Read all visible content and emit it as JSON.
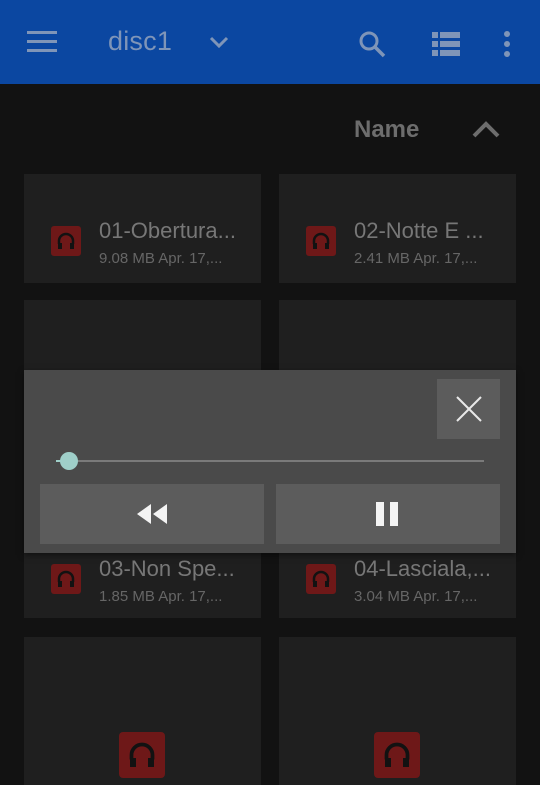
{
  "appbar": {
    "folder_title": "disc1",
    "background": "#0b47a1"
  },
  "sort": {
    "label": "Name",
    "direction": "ascending"
  },
  "files": [
    {
      "name": "01-Obertura...",
      "size": "9.08 MB",
      "date": "Apr. 17,..."
    },
    {
      "name": "02-Notte E ...",
      "size": "2.41 MB",
      "date": "Apr. 17,..."
    },
    {
      "name": "03-Non Spe...",
      "size": "1.85 MB",
      "date": "Apr. 17,..."
    },
    {
      "name": "04-Lasciala,...",
      "size": "3.04 MB",
      "date": "Apr. 17,..."
    }
  ],
  "player": {
    "progress": 0.03,
    "accent": "#9fcfc9",
    "icons": [
      "close-icon",
      "rewind-icon",
      "pause-icon"
    ]
  },
  "file_icon": "headphones-icon",
  "icon_color": "#6e1818"
}
